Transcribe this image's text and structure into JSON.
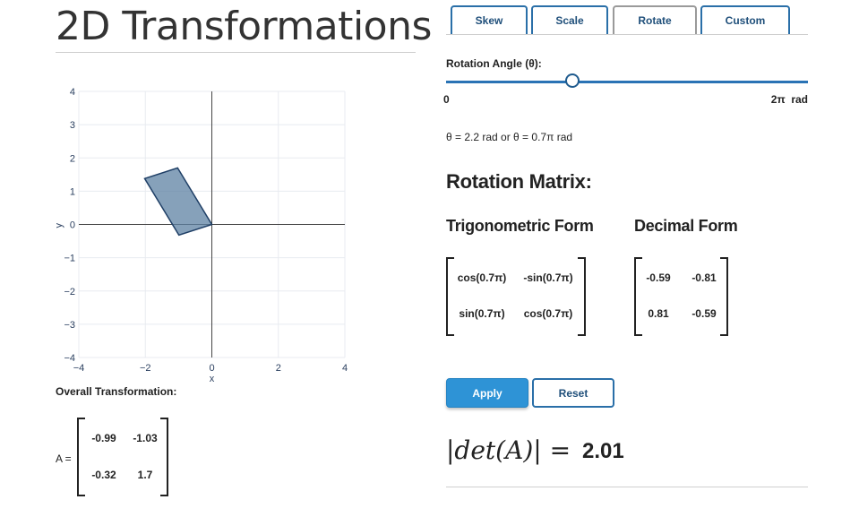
{
  "title": "2D Transformations",
  "plot": {
    "x_ticks": [
      "−4",
      "−2",
      "0",
      "2",
      "4"
    ],
    "y_ticks": [
      "4",
      "3",
      "2",
      "1",
      "0",
      "−1",
      "−2",
      "−3",
      "−4"
    ],
    "xlabel": "x",
    "ylabel": "y"
  },
  "chart_data": {
    "type": "area",
    "xlim": [
      -4,
      4
    ],
    "ylim": [
      -4,
      4
    ],
    "grid": true,
    "polygon": [
      [
        0,
        0
      ],
      [
        -0.99,
        -0.32
      ],
      [
        -2.02,
        1.38
      ],
      [
        -1.03,
        1.7
      ]
    ],
    "fill_color": "#5d81a3",
    "stroke_color": "#1f3f66"
  },
  "overall": {
    "label": "Overall Transformation:",
    "matrix_name": "A =",
    "m11": "-0.99",
    "m12": "-1.03",
    "m21": "-0.32",
    "m22": "1.7"
  },
  "tabs": [
    {
      "label": "Skew"
    },
    {
      "label": "Scale"
    },
    {
      "label": "Rotate"
    },
    {
      "label": "Custom"
    }
  ],
  "active_tab": "Rotate",
  "slider": {
    "label": "Rotation Angle (θ):",
    "min_label": "0",
    "max_label": "2π  rad",
    "value_fraction": 0.35
  },
  "angle_readout": "θ = 2.2 rad or θ = 0.7π rad",
  "matrix_heading": "Rotation Matrix:",
  "trig": {
    "heading": "Trigonometric Form",
    "m11": "cos(0.7π)",
    "m12": "-sin(0.7π)",
    "m21": "sin(0.7π)",
    "m22": "cos(0.7π)"
  },
  "decimal": {
    "heading": "Decimal Form",
    "m11": "-0.59",
    "m12": "-0.81",
    "m21": "0.81",
    "m22": "-0.59"
  },
  "buttons": {
    "apply": "Apply",
    "reset": "Reset"
  },
  "det": {
    "expr": "|det(A)| =",
    "value": "2.01"
  },
  "colors": {
    "accent": "#2e93d6",
    "tab_border": "#2a6fa8",
    "slider": "#2a73b5"
  }
}
